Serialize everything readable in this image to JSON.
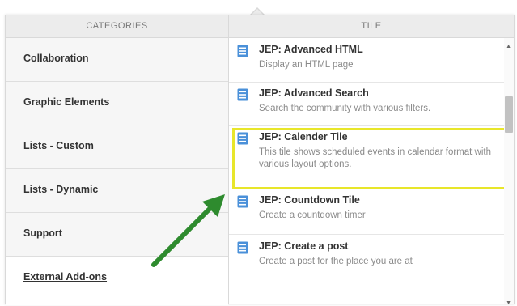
{
  "categories": {
    "header": "CATEGORIES",
    "items": [
      {
        "label": "Collaboration"
      },
      {
        "label": "Graphic Elements"
      },
      {
        "label": "Lists - Custom"
      },
      {
        "label": "Lists - Dynamic"
      },
      {
        "label": "Support"
      },
      {
        "label": "External Add-ons"
      }
    ],
    "active": "External Add-ons"
  },
  "tiles": {
    "header": "TILE",
    "items": [
      {
        "title": "JEP: Advanced HTML",
        "description": "Display an HTML page"
      },
      {
        "title": "JEP: Advanced Search",
        "description": "Search the community with various filters."
      },
      {
        "title": "JEP: Calender Tile",
        "description": "This tile shows scheduled events in calendar format with various layout options."
      },
      {
        "title": "JEP: Countdown Tile",
        "description": "Create a countdown timer"
      },
      {
        "title": "JEP: Create a post",
        "description": "Create a post for the place you are at"
      }
    ],
    "highlighted": "JEP: Calender Tile"
  },
  "colors": {
    "highlight_border": "#e8e62a",
    "annotation_arrow": "#2e8b2e",
    "tile_icon": "#4a90d9"
  },
  "icons": {
    "tile": "tile-icon",
    "annotation": "green-arrow-icon"
  }
}
